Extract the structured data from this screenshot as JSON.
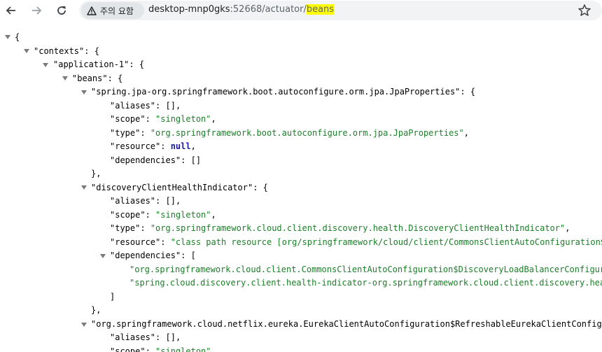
{
  "browser": {
    "security_label": "주의 요함",
    "url_host": "desktop-mnp0gks",
    "url_port_path": ":52668/actuator/",
    "url_highlight": "beans",
    "icons": [
      "back-arrow-icon",
      "forward-arrow-icon",
      "reload-icon",
      "warning-icon",
      "bookmark-star-icon"
    ]
  },
  "json": {
    "contexts_key": "\"contexts\"",
    "app_key": "\"application-1\"",
    "beans_key": "\"beans\"",
    "bean1_key": "\"spring.jpa-org.springframework.boot.autoconfigure.orm.jpa.JpaProperties\"",
    "bean1_type": "\"org.springframework.boot.autoconfigure.orm.jpa.JpaProperties\"",
    "bean2_key": "\"discoveryClientHealthIndicator\"",
    "bean2_type": "\"org.springframework.cloud.client.discovery.health.DiscoveryClientHealthIndicator\"",
    "bean2_resource": "\"class path resource [org/springframework/cloud/client/CommonsClientAutoConfiguration$DiscoveryClientHealthIndicatorConfiguration.class]\"",
    "bean2_dep1": "\"org.springframework.cloud.client.CommonsClientAutoConfiguration$DiscoveryLoadBalancerConfiguration\"",
    "bean2_dep2": "\"spring.cloud.discovery.client.health-indicator-org.springframework.cloud.client.discovery.health.DiscoveryClientHealthIndicatorProperties\"",
    "bean3_key": "\"org.springframework.cloud.netflix.eureka.EurekaClientAutoConfiguration$RefreshableEurekaClientConfiguration\"",
    "aliases_key": "\"aliases\"",
    "scope_key": "\"scope\"",
    "type_key": "\"type\"",
    "resource_key": "\"resource\"",
    "dependencies_key": "\"dependencies\"",
    "singleton_value": "\"singleton\"",
    "null_value": "null",
    "empty_array": "[]"
  }
}
